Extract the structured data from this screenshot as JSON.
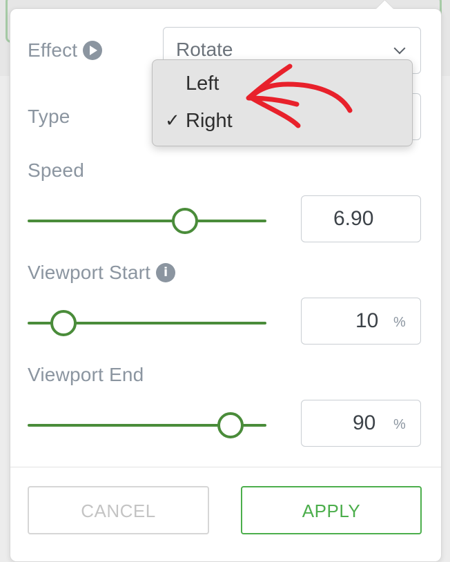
{
  "effect": {
    "label": "Effect",
    "value": "Rotate"
  },
  "type": {
    "label": "Type"
  },
  "dropdown": {
    "options": [
      {
        "label": "Left",
        "checked": false
      },
      {
        "label": "Right",
        "checked": true
      }
    ],
    "check_mark": "✓"
  },
  "speed": {
    "label": "Speed",
    "value": "6.90",
    "level": 0.66
  },
  "viewport_start": {
    "label": "Viewport Start",
    "value": "10",
    "unit": "%",
    "level": 0.15
  },
  "viewport_end": {
    "label": "Viewport End",
    "value": "90",
    "unit": "%",
    "level": 0.85
  },
  "buttons": {
    "cancel": "CANCEL",
    "apply": "APPLY"
  },
  "colors": {
    "accent_green": "#4a8c3a",
    "apply_green": "#4cae4c",
    "annotation_red": "#e8212b"
  },
  "icons": {
    "effect_info": "play-circle-icon",
    "viewport_info": "info-icon",
    "select_chevron": "chevron-down-icon"
  }
}
